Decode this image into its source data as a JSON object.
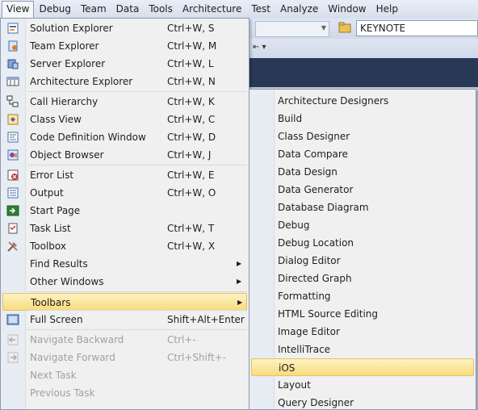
{
  "menubar": [
    "View",
    "Debug",
    "Team",
    "Data",
    "Tools",
    "Architecture",
    "Test",
    "Analyze",
    "Window",
    "Help"
  ],
  "toolbar": {
    "config_value": "KEYNOTE"
  },
  "view_menu": {
    "items": [
      {
        "label": "Solution Explorer",
        "shortcut": "Ctrl+W, S",
        "icon": "solution-explorer-icon"
      },
      {
        "label": "Team Explorer",
        "shortcut": "Ctrl+W, M",
        "icon": "team-explorer-icon"
      },
      {
        "label": "Server Explorer",
        "shortcut": "Ctrl+W, L",
        "icon": "server-explorer-icon"
      },
      {
        "label": "Architecture Explorer",
        "shortcut": "Ctrl+W, N",
        "icon": "architecture-explorer-icon"
      },
      {
        "label": "Call Hierarchy",
        "shortcut": "Ctrl+W, K",
        "icon": "call-hierarchy-icon"
      },
      {
        "label": "Class View",
        "shortcut": "Ctrl+W, C",
        "icon": "class-view-icon"
      },
      {
        "label": "Code Definition Window",
        "shortcut": "Ctrl+W, D",
        "icon": "code-definition-icon"
      },
      {
        "label": "Object Browser",
        "shortcut": "Ctrl+W, J",
        "icon": "object-browser-icon"
      },
      {
        "label": "Error List",
        "shortcut": "Ctrl+W, E",
        "icon": "error-list-icon"
      },
      {
        "label": "Output",
        "shortcut": "Ctrl+W, O",
        "icon": "output-icon"
      },
      {
        "label": "Start Page",
        "shortcut": "",
        "icon": "start-page-icon"
      },
      {
        "label": "Task List",
        "shortcut": "Ctrl+W, T",
        "icon": "task-list-icon"
      },
      {
        "label": "Toolbox",
        "shortcut": "Ctrl+W, X",
        "icon": "toolbox-icon"
      },
      {
        "label": "Find Results",
        "shortcut": "",
        "icon": ""
      },
      {
        "label": "Other Windows",
        "shortcut": "",
        "icon": ""
      },
      {
        "label": "Toolbars",
        "shortcut": "",
        "icon": ""
      },
      {
        "label": "Full Screen",
        "shortcut": "Shift+Alt+Enter",
        "icon": "full-screen-icon"
      },
      {
        "label": "Navigate Backward",
        "shortcut": "Ctrl+-",
        "icon": "navigate-backward-icon"
      },
      {
        "label": "Navigate Forward",
        "shortcut": "Ctrl+Shift+-",
        "icon": "navigate-forward-icon"
      },
      {
        "label": "Next Task",
        "shortcut": "",
        "icon": ""
      },
      {
        "label": "Previous Task",
        "shortcut": "",
        "icon": ""
      }
    ]
  },
  "toolbars_submenu": {
    "items": [
      "Architecture Designers",
      "Build",
      "Class Designer",
      "Data Compare",
      "Data Design",
      "Data Generator",
      "Database Diagram",
      "Debug",
      "Debug Location",
      "Dialog Editor",
      "Directed Graph",
      "Formatting",
      "HTML Source Editing",
      "Image Editor",
      "IntelliTrace",
      "iOS",
      "Layout",
      "Query Designer"
    ],
    "highlighted": "iOS"
  }
}
